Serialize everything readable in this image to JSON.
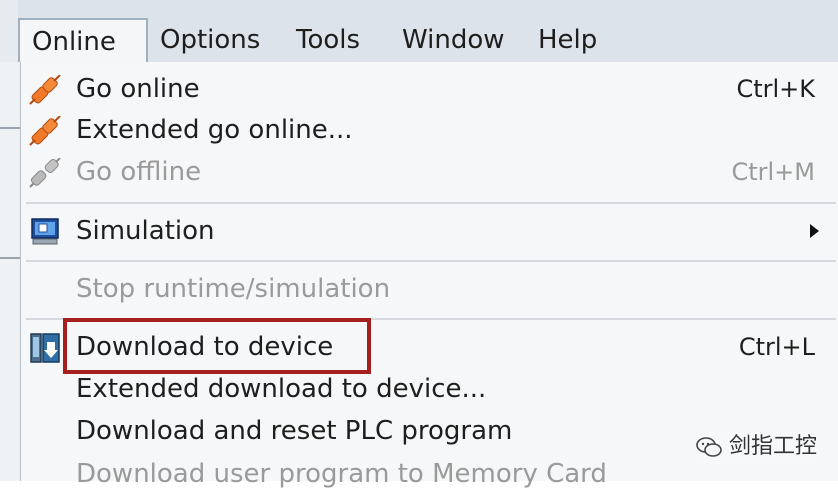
{
  "menubar": {
    "items": [
      {
        "label": "Online",
        "active": true
      },
      {
        "label": "Options"
      },
      {
        "label": "Tools"
      },
      {
        "label": "Window"
      },
      {
        "label": "Help"
      }
    ]
  },
  "menu": {
    "go_online": {
      "label": "Go online",
      "shortcut": "Ctrl+K",
      "icon": "go-online-icon"
    },
    "extended_go_online": {
      "label": "Extended go online...",
      "icon": "go-online-icon"
    },
    "go_offline": {
      "label": "Go offline",
      "shortcut": "Ctrl+M",
      "icon": "go-offline-icon",
      "disabled": true
    },
    "simulation": {
      "label": "Simulation",
      "icon": "simulation-icon",
      "submenu": true
    },
    "stop_runtime": {
      "label": "Stop runtime/simulation",
      "disabled": true
    },
    "download_to_device": {
      "label": "Download to device",
      "shortcut": "Ctrl+L",
      "icon": "download-icon",
      "highlighted": true
    },
    "extended_download": {
      "label": "Extended download to device..."
    },
    "download_reset": {
      "label": "Download and reset PLC program"
    },
    "download_memory_card": {
      "label": "Download user program to Memory Card",
      "disabled": true
    }
  },
  "watermark": {
    "text": "剑指工控"
  },
  "colors": {
    "highlight_border": "#a51f1f",
    "plug_orange": "#f07a28",
    "disabled_text": "#9a9a9a"
  }
}
